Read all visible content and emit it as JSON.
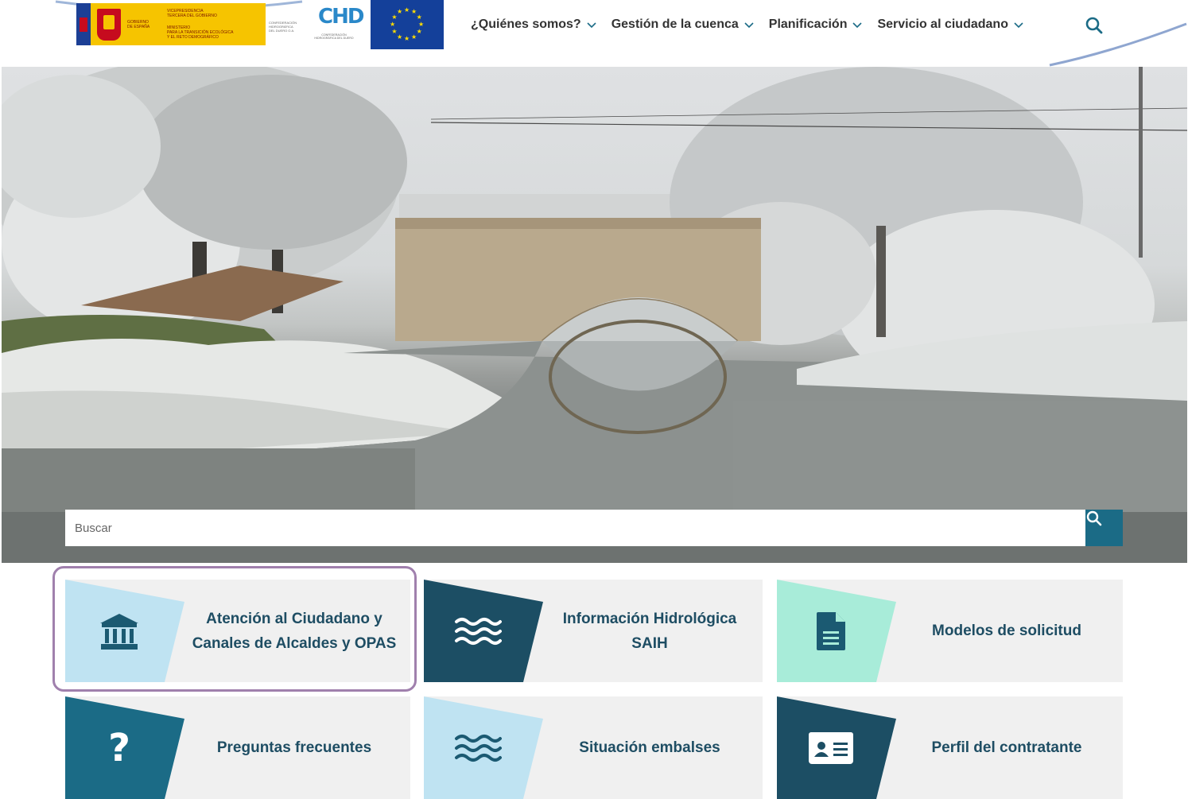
{
  "header": {
    "gov_logo": {
      "country": "GOBIERNO\nDE ESPAÑA",
      "ministry_top": "VICEPRESIDENCIA\nTERCERA DEL GOBIERNO",
      "ministry": "MINISTERIO\nPARA LA TRANSICIÓN ECOLÓGICA\nY EL RETO DEMOGRÁFICO"
    },
    "chd_logo": {
      "org": "CONFEDERACIÓN\nHIDROGRÁFICA\nDEL DUERO O.A.",
      "mark": "CHD",
      "sub": "CONFEDERACIÓN HIDROGRÁFICA DEL DUERO"
    },
    "nav": [
      {
        "label": "¿Quiénes somos?"
      },
      {
        "label": "Gestión de la cuenca"
      },
      {
        "label": "Planificación"
      },
      {
        "label": "Servicio al ciudadano"
      }
    ]
  },
  "hero": {
    "search_placeholder": "Buscar"
  },
  "tiles": [
    {
      "label": "Atención al Ciudadano y Canales de Alcaldes y OPAS",
      "icon": "bank-icon",
      "shape_color": "#bfe3f2",
      "icon_color": "#1b5a72"
    },
    {
      "label": "Información Hidrológica SAIH",
      "icon": "waves-icon",
      "shape_color": "#1c4e64",
      "icon_color": "#ffffff"
    },
    {
      "label": "Modelos de solicitud",
      "icon": "document-icon",
      "shape_color": "#a8ecd9",
      "icon_color": "#1b5a72"
    },
    {
      "label": "Preguntas frecuentes",
      "icon": "question-icon",
      "shape_color": "#1b6b86",
      "icon_color": "#ffffff"
    },
    {
      "label": "Situación embalses",
      "icon": "waves-icon",
      "shape_color": "#bfe3f2",
      "icon_color": "#1b5a72"
    },
    {
      "label": "Perfil del contratante",
      "icon": "id-card-icon",
      "shape_color": "#1c4e64",
      "icon_color": "#ffffff"
    }
  ],
  "colors": {
    "accent": "#1b6b86",
    "tile_text": "#1e4d63",
    "highlight": "#a080ad"
  }
}
